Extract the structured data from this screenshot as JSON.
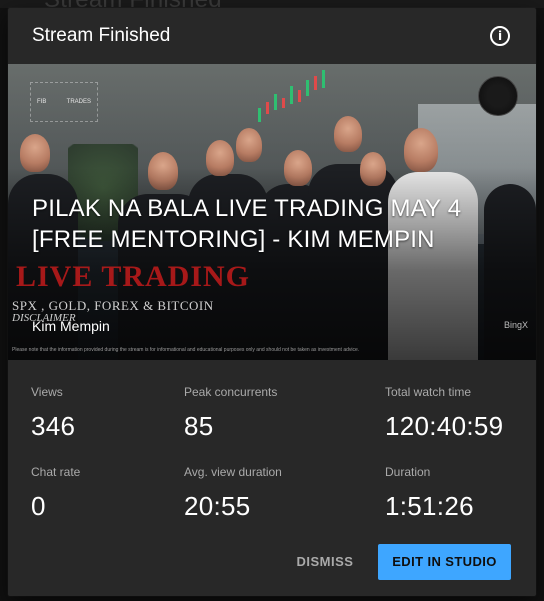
{
  "background": {
    "ghost_title": "Stream Finished"
  },
  "dialog": {
    "title": "Stream Finished",
    "info_icon": "info-icon",
    "colors": {
      "surface": "#282828",
      "accent": "#3ea6ff",
      "muted": "#aaaaaa"
    }
  },
  "thumbnail": {
    "logo_left": "FIB",
    "logo_right": "TRADES",
    "overlay_heading": "LIVE TRADING",
    "overlay_caption": "SPX , GOLD, FOREX & BITCOIN",
    "overlay_disclaimer_heading": "DISCLAIMER",
    "overlay_disclaimer_text": "Please note that the information provided during the stream is for informational and educational purposes only and should not be taken as investment advice.",
    "overlay_brand": "BingX"
  },
  "video": {
    "title": "PILAK NA BALA LIVE TRADING MAY 4 [FREE MENTORING] - KIM MEMPIN",
    "channel": "Kim Mempin"
  },
  "stats": {
    "views": {
      "label": "Views",
      "value": "346"
    },
    "peak_concurrents": {
      "label": "Peak concurrents",
      "value": "85"
    },
    "total_watch_time": {
      "label": "Total watch time",
      "value": "120:40:59"
    },
    "chat_rate": {
      "label": "Chat rate",
      "value": "0"
    },
    "avg_view_duration": {
      "label": "Avg. view duration",
      "value": "20:55"
    },
    "duration": {
      "label": "Duration",
      "value": "1:51:26"
    }
  },
  "actions": {
    "dismiss_label": "DISMISS",
    "edit_label": "EDIT IN STUDIO"
  }
}
